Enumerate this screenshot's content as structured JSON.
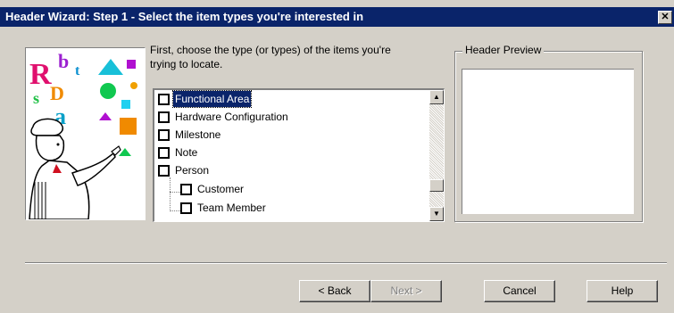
{
  "window": {
    "title": "Header Wizard: Step 1 - Select the item types you're interested in",
    "close_glyph": "✕"
  },
  "instructions": "First, choose the type (or types) of the items you're\ntrying to locate.",
  "item_types": [
    {
      "label": "Functional Area",
      "checked": false,
      "selected": true,
      "indent": 0
    },
    {
      "label": "Hardware Configuration",
      "checked": false,
      "selected": false,
      "indent": 0
    },
    {
      "label": "Milestone",
      "checked": false,
      "selected": false,
      "indent": 0
    },
    {
      "label": "Note",
      "checked": false,
      "selected": false,
      "indent": 0
    },
    {
      "label": "Person",
      "checked": false,
      "selected": false,
      "indent": 0
    },
    {
      "label": "Customer",
      "checked": false,
      "selected": false,
      "indent": 1
    },
    {
      "label": "Team Member",
      "checked": false,
      "selected": false,
      "indent": 1
    }
  ],
  "preview": {
    "label": "Header Preview"
  },
  "illustration": {
    "letters": [
      "R",
      "b",
      "t",
      "s",
      "D",
      "a"
    ],
    "icon": "wizard-chef-icon"
  },
  "buttons": {
    "back": "< Back",
    "next": "Next >",
    "cancel": "Cancel",
    "help": "Help"
  },
  "colors": {
    "titlebar": "#0a246a",
    "face": "#d4d0c8",
    "selection": "#0a246a"
  }
}
